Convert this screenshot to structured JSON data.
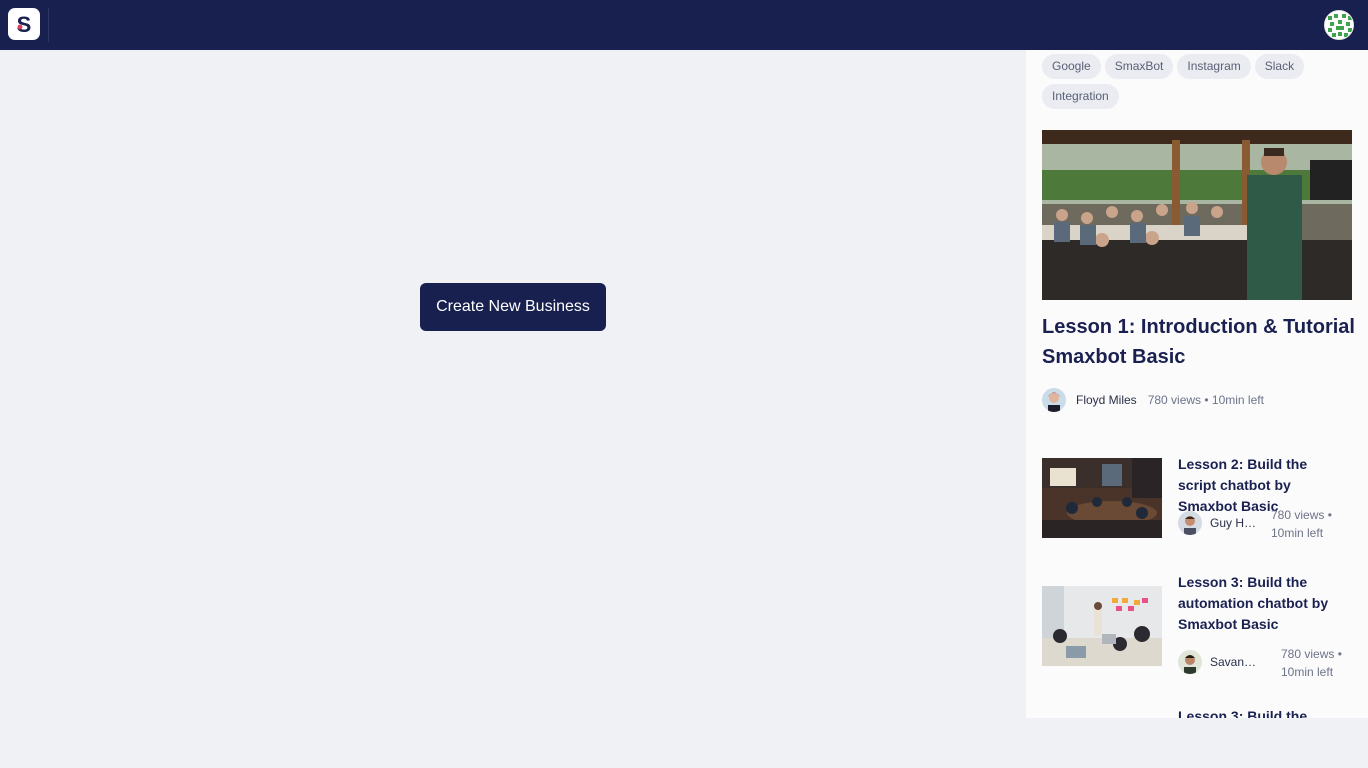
{
  "app": {
    "name": "SmaxBot",
    "logo_letter": "S"
  },
  "main": {
    "create_button_label": "Create New Business"
  },
  "panel": {
    "tags": [
      "Google",
      "SmaxBot",
      "Instagram",
      "Slack",
      "Integration"
    ],
    "featured": {
      "title": "Lesson 1: Introduction & Tutorial Smaxbot Basic",
      "author": "Floyd Miles",
      "stats": "780 views • 10min left"
    },
    "lessons": [
      {
        "title": "Lesson 2: Build the script chatbot by Smaxbot Basic",
        "author": "Guy Ha...",
        "stats": "780 views • 10min left"
      },
      {
        "title": "Lesson 3: Build the automation chatbot by Smaxbot Basic",
        "author": "Savanna...",
        "stats": "780 views • 10min left"
      },
      {
        "title": "Lesson 3: Build the"
      }
    ]
  },
  "colors": {
    "navy": "#17204e",
    "background": "#eff1f5",
    "panel": "#fbfbfc",
    "tag": "#eaecf1"
  }
}
